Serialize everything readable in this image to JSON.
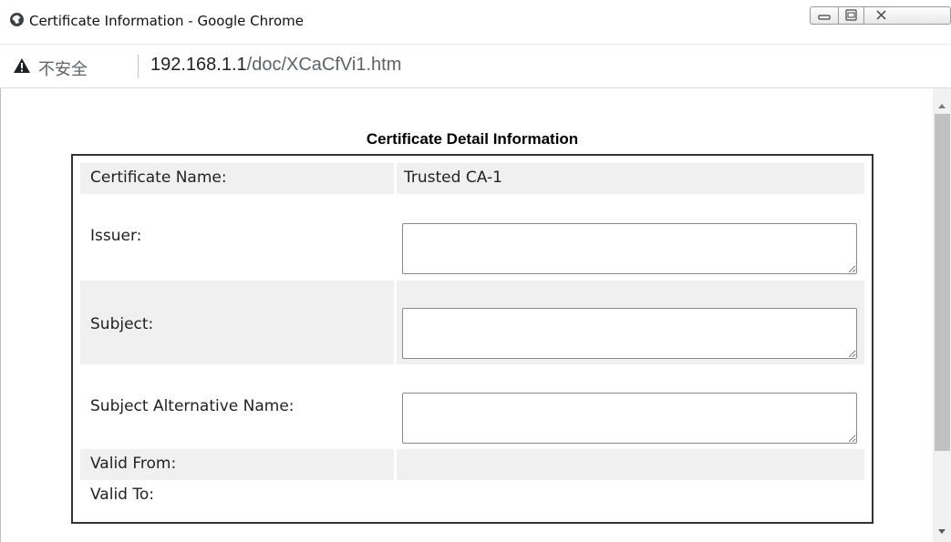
{
  "window": {
    "title": "Certificate Information - Google Chrome",
    "buttons": {
      "minimize": "minimize",
      "maximize": "maximize",
      "close": "close"
    }
  },
  "address_bar": {
    "security_label": "不安全",
    "url_host": "192.168.1.1",
    "url_path": "/doc/XCaCfVi1.htm"
  },
  "page": {
    "heading": "Certificate Detail Information",
    "rows": [
      {
        "label": "Certificate Name:",
        "value": "Trusted CA-1"
      },
      {
        "label": "Issuer:",
        "value": ""
      },
      {
        "label": "Subject:",
        "value": ""
      },
      {
        "label": "Subject Alternative Name:",
        "value": ""
      },
      {
        "label": "Valid From:",
        "value": ""
      },
      {
        "label": "Valid To:",
        "value": ""
      }
    ]
  },
  "colors": {
    "row_shade": "#f0f0f0",
    "panel_border": "#333333",
    "scroll_thumb": "#c1c1c1",
    "warning_icon": "#202124"
  },
  "icons": {
    "title": "chrome-globe-icon",
    "security": "warning-triangle-icon",
    "scroll_up": "arrow-up-icon",
    "scroll_down": "arrow-down-icon"
  }
}
